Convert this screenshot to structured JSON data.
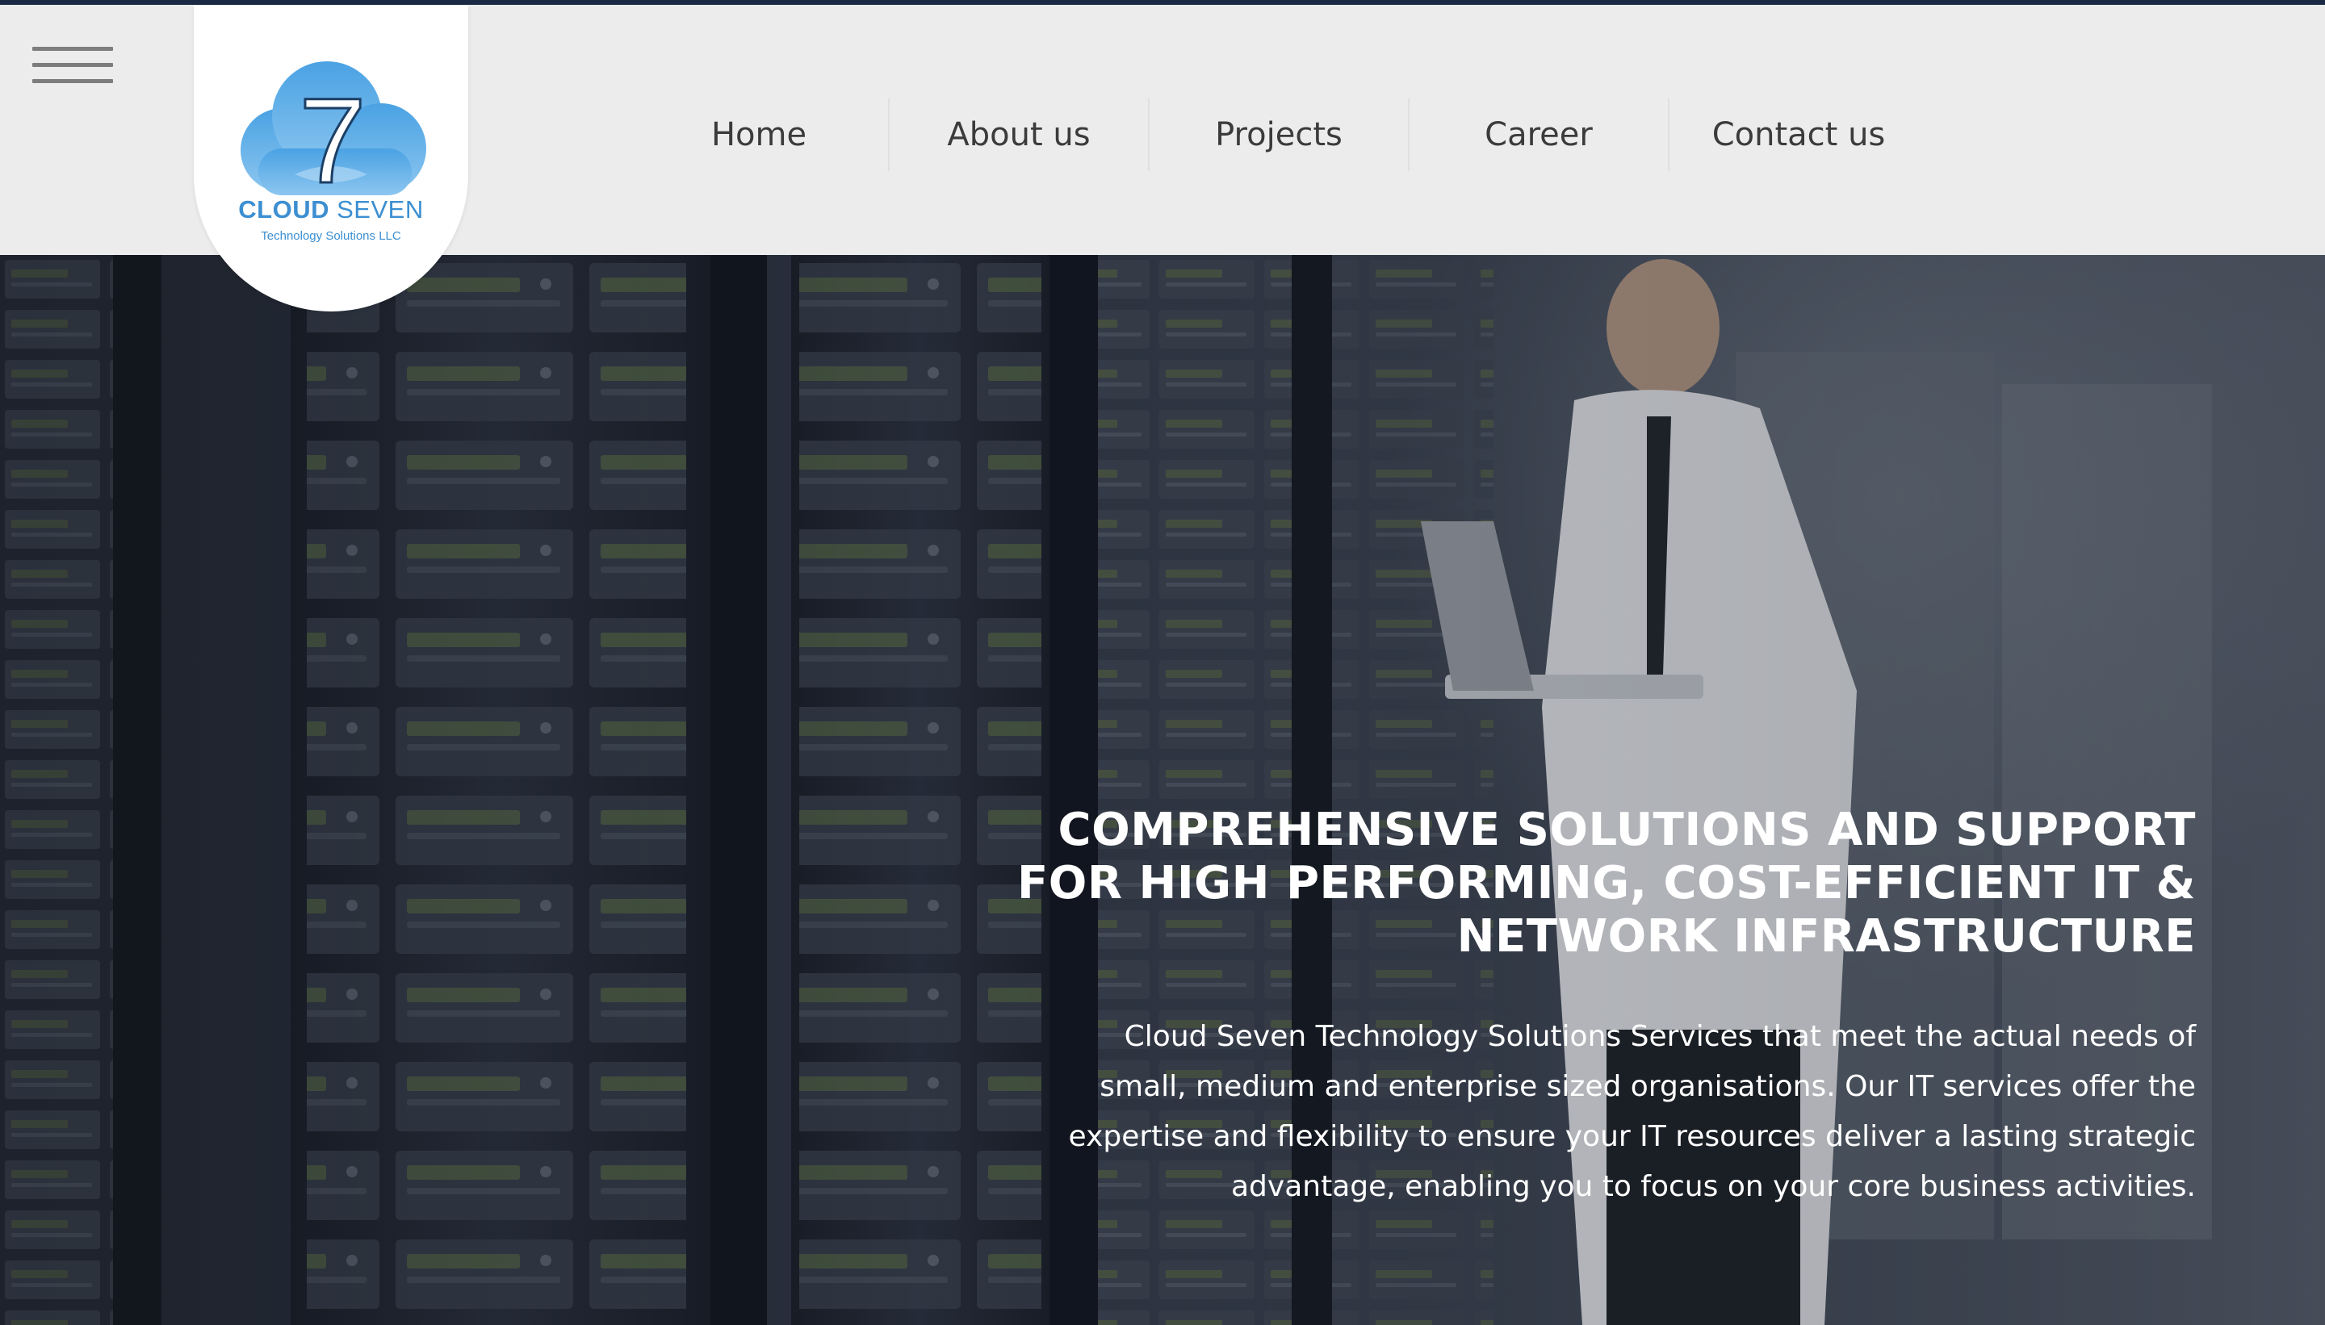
{
  "logo": {
    "number": "7",
    "name_bold": "CLOUD",
    "name_light": "SEVEN",
    "subtitle": "Technology Solutions LLC"
  },
  "menu": {
    "icon": "hamburger-menu-icon"
  },
  "nav": {
    "items": [
      {
        "label": "Home"
      },
      {
        "label": "About us"
      },
      {
        "label": "Projects"
      },
      {
        "label": "Career"
      },
      {
        "label": "Contact us"
      }
    ]
  },
  "hero": {
    "heading_line1": "COMPREHENSIVE SOLUTIONS AND SUPPORT",
    "heading_line2": "FOR HIGH PERFORMING, COST-EFFICIENT IT &",
    "heading_line3": "NETWORK INFRASTRUCTURE",
    "description": "Cloud Seven Technology Solutions Services that meet the actual needs of small, medium and enterprise sized organisations. Our IT services offer the expertise and flexibility to ensure your IT resources deliver a lasting strategic advantage, enabling you to focus on your core business activities."
  },
  "colors": {
    "top_strip": "#1b2a44",
    "header_bg": "#ececec",
    "logo_blue": "#3c8fd1",
    "nav_text": "#3b3b3b",
    "hero_text": "#ffffff"
  }
}
